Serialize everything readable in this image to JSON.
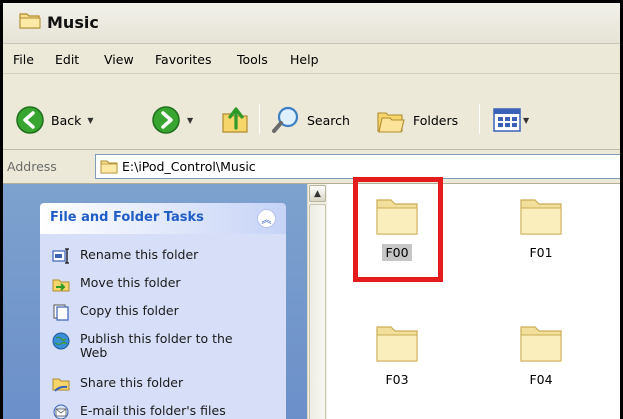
{
  "window": {
    "title": "Music"
  },
  "menu": [
    "File",
    "Edit",
    "View",
    "Favorites",
    "Tools",
    "Help"
  ],
  "toolbar": {
    "back": "Back",
    "search": "Search",
    "folders": "Folders"
  },
  "address": {
    "label": "Address",
    "path": "E:\\iPod_Control\\Music"
  },
  "tasks": {
    "title": "File and Folder Tasks",
    "items": [
      {
        "label": "Rename this folder",
        "icon": "rename-icon"
      },
      {
        "label": "Move this folder",
        "icon": "move-icon"
      },
      {
        "label": "Copy this folder",
        "icon": "copy-icon"
      },
      {
        "label": "Publish this folder to the Web",
        "icon": "publish-web-icon"
      },
      {
        "label": "Share this folder",
        "icon": "share-icon"
      },
      {
        "label": "E-mail this folder's files",
        "icon": "email-icon"
      }
    ]
  },
  "folders": [
    {
      "name": "F00",
      "selected": true
    },
    {
      "name": "F01",
      "selected": false
    },
    {
      "name": "F03",
      "selected": false
    },
    {
      "name": "F04",
      "selected": false
    }
  ],
  "colors": {
    "highlight": "#e41c1c",
    "task_link": "#215dc6"
  }
}
